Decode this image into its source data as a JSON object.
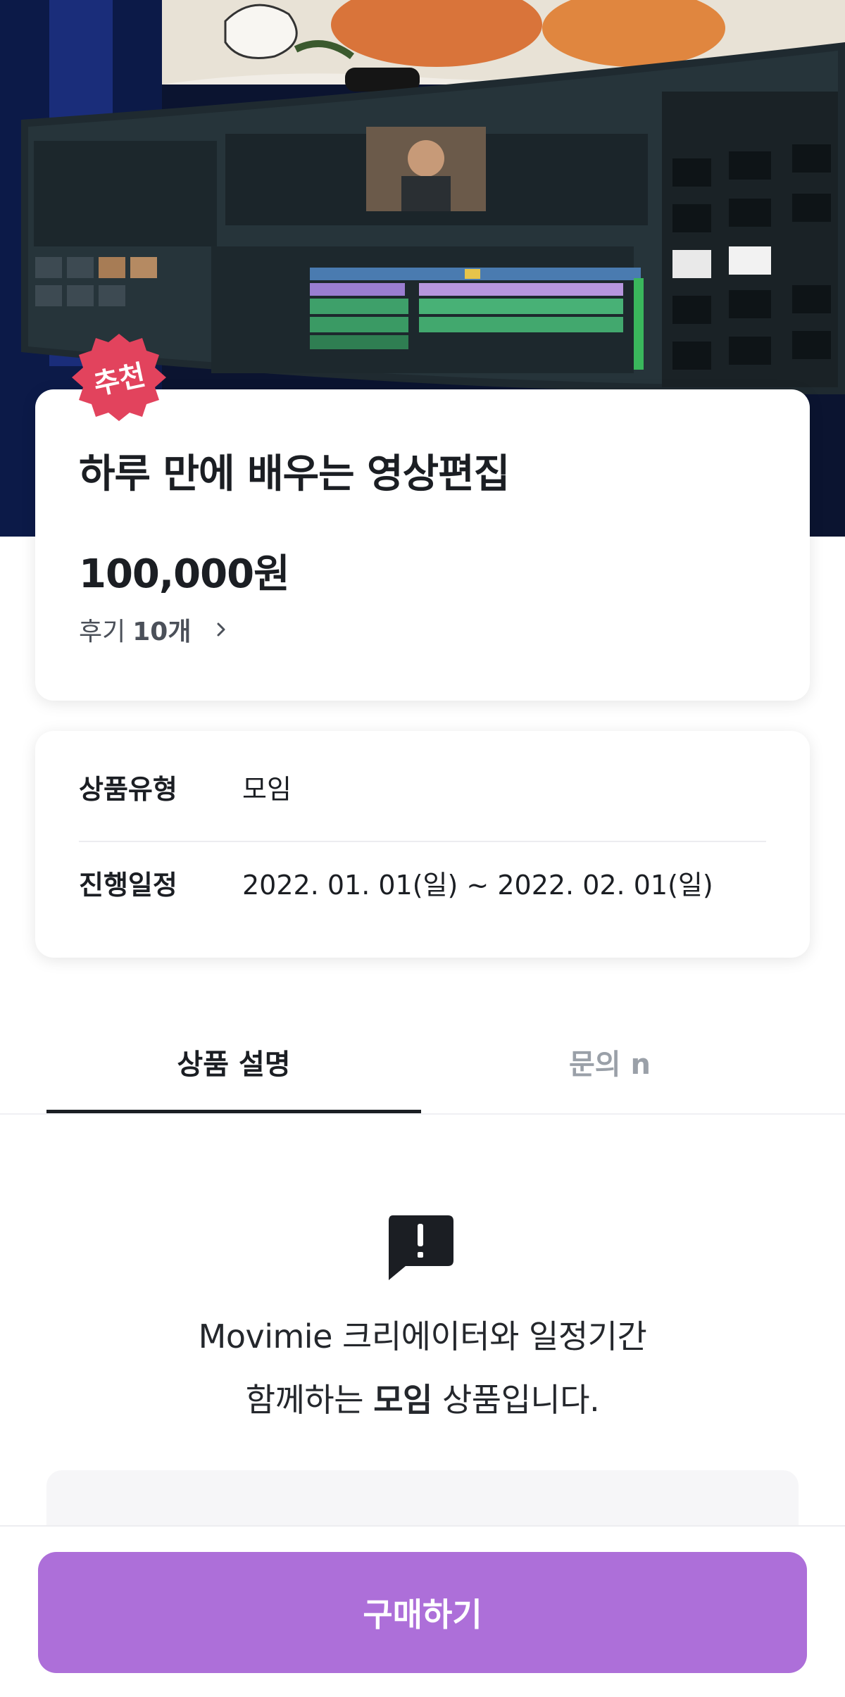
{
  "product": {
    "badge": "추천",
    "title": "하루 만에 배우는 영상편집",
    "price": "100,000원",
    "reviews_label": "후기",
    "reviews_count": "10개"
  },
  "info": {
    "rows": [
      {
        "label": "상품유형",
        "value": "모임"
      },
      {
        "label": "진행일정",
        "value": "2022. 01. 01(일) ~ 2022. 02. 01(일)"
      }
    ]
  },
  "tabs": [
    {
      "label": "상품 설명",
      "active": true
    },
    {
      "label": "문의 n",
      "active": false
    }
  ],
  "description": {
    "line1": "Movimie 크리에이터와 일정기간",
    "line2_pre": "함께하는 ",
    "line2_bold": "모임",
    "line2_post": " 상품입니다."
  },
  "cta": {
    "buy_label": "구매하기"
  },
  "colors": {
    "accent": "#ad6fd9",
    "badge": "#e2435d",
    "text": "#1b1e23"
  },
  "icons": [
    "alert-message-icon",
    "chevron-right-icon"
  ]
}
